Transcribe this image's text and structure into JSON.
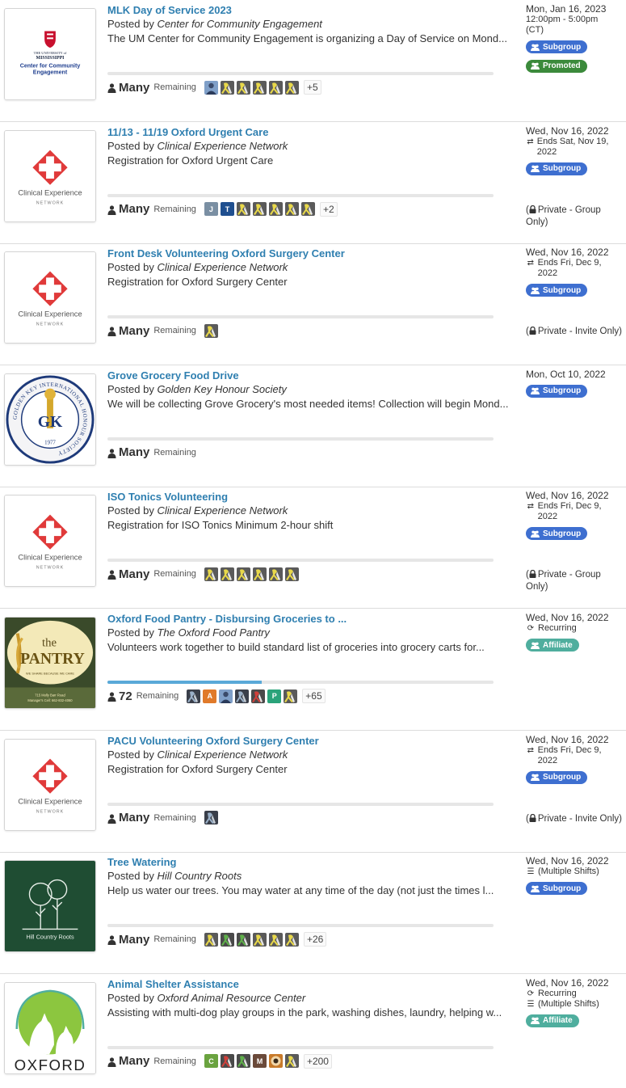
{
  "events": [
    {
      "title": "MLK Day of Service 2023",
      "posted_prefix": "Posted by ",
      "org": "Center for Community Engagement",
      "desc": "The UM Center for Community Engagement is organizing a Day of Service on  Mond...",
      "logo": "ole-miss",
      "logo_text": [
        "THE UNIVERSITY of",
        "MISSISSIPPI",
        "Center for Community",
        "Engagement"
      ],
      "count": "Many",
      "remaining": "Remaining",
      "progress": null,
      "avatars": [
        "photo-person",
        "ribbon",
        "ribbon",
        "ribbon",
        "ribbon",
        "ribbon"
      ],
      "more": "+5",
      "date": "Mon, Jan 16, 2023",
      "sublines": [
        {
          "icon": "",
          "text": "12:00pm - 5:00pm"
        },
        {
          "icon": "",
          "text": "(CT)"
        }
      ],
      "badges": [
        {
          "type": "sub",
          "label": "Subgroup"
        },
        {
          "type": "promo",
          "label": "Promoted"
        }
      ],
      "privacy": ""
    },
    {
      "title": "11/13 - 11/19 Oxford Urgent Care",
      "posted_prefix": "Posted by ",
      "org": "Clinical Experience Network",
      "desc": "Registration for Oxford Urgent Care",
      "logo": "clinical",
      "logo_text": [
        "Clinical Experience",
        "NETWORK"
      ],
      "count": "Many",
      "remaining": "Remaining",
      "progress": null,
      "avatars": [
        "letter-J",
        "letter-T",
        "ribbon",
        "ribbon",
        "ribbon",
        "ribbon",
        "ribbon"
      ],
      "more": "+2",
      "date": "Wed, Nov 16, 2022",
      "sublines": [
        {
          "icon": "⇄",
          "text": "Ends Sat, Nov 19, 2022"
        }
      ],
      "badges": [
        {
          "type": "sub",
          "label": "Subgroup"
        }
      ],
      "privacy": "Private - Group Only)"
    },
    {
      "title": "Front Desk Volunteering Oxford Surgery Center",
      "posted_prefix": "Posted by ",
      "org": "Clinical Experience Network",
      "desc": "Registration for Oxford Surgery Center",
      "logo": "clinical",
      "logo_text": [
        "Clinical Experience",
        "NETWORK"
      ],
      "count": "Many",
      "remaining": "Remaining",
      "progress": null,
      "avatars": [
        "ribbon"
      ],
      "more": "",
      "date": "Wed, Nov 16, 2022",
      "sublines": [
        {
          "icon": "⇄",
          "text": "Ends Fri, Dec 9, 2022"
        }
      ],
      "badges": [
        {
          "type": "sub",
          "label": "Subgroup"
        }
      ],
      "privacy": "Private - Invite Only)"
    },
    {
      "title": "Grove Grocery Food Drive",
      "posted_prefix": "Posted by ",
      "org": "Golden Key Honour Society",
      "desc": "We will be collecting Grove Grocery's most needed items! Collection will begin Mond...",
      "logo": "golden-key",
      "logo_text": [
        "GOLDEN KEY INTERNATIONAL HONOUR SOCIETY",
        "GK",
        "1977"
      ],
      "count": "Many",
      "remaining": "Remaining",
      "progress": null,
      "avatars": [],
      "more": "",
      "date": "Mon, Oct 10, 2022",
      "sublines": [],
      "badges": [
        {
          "type": "sub",
          "label": "Subgroup"
        }
      ],
      "privacy": ""
    },
    {
      "title": "ISO Tonics Volunteering",
      "posted_prefix": "Posted by ",
      "org": "Clinical Experience Network",
      "desc": "Registration for ISO Tonics Minimum 2-hour shift",
      "logo": "clinical",
      "logo_text": [
        "Clinical Experience",
        "NETWORK"
      ],
      "count": "Many",
      "remaining": "Remaining",
      "progress": null,
      "avatars": [
        "ribbon",
        "ribbon",
        "ribbon",
        "ribbon",
        "ribbon",
        "ribbon"
      ],
      "more": "",
      "date": "Wed, Nov 16, 2022",
      "sublines": [
        {
          "icon": "⇄",
          "text": "Ends Fri, Dec 9, 2022"
        }
      ],
      "badges": [
        {
          "type": "sub",
          "label": "Subgroup"
        }
      ],
      "privacy": "Private - Group Only)"
    },
    {
      "title": "Oxford Food Pantry - Disbursing Groceries to ...",
      "posted_prefix": "Posted by ",
      "org": "The Oxford Food Pantry",
      "desc": "Volunteers work together to build standard list of groceries into grocery carts for...",
      "logo": "pantry",
      "logo_text": [
        "the",
        "PANTRY",
        "WE SHARE BECAUSE WE CARE",
        "715 Molly Barr Road",
        "Manager's Cell: 662-832-4060"
      ],
      "count": "72",
      "remaining": "Remaining",
      "progress": 0.4,
      "avatars": [
        "ribbon-dark",
        "letter-A",
        "photo-person",
        "ribbon-dark",
        "ribbon-red",
        "letter-P",
        "ribbon"
      ],
      "more": "+65",
      "date": "Wed, Nov 16, 2022",
      "sublines": [
        {
          "icon": "⟳",
          "text": "Recurring"
        }
      ],
      "badges": [
        {
          "type": "aff",
          "label": "Affiliate"
        }
      ],
      "privacy": ""
    },
    {
      "title": "PACU Volunteering Oxford Surgery Center",
      "posted_prefix": "Posted by ",
      "org": "Clinical Experience Network",
      "desc": "Registration for Oxford Surgery Center",
      "logo": "clinical",
      "logo_text": [
        "Clinical Experience",
        "NETWORK"
      ],
      "count": "Many",
      "remaining": "Remaining",
      "progress": null,
      "avatars": [
        "ribbon-dark"
      ],
      "more": "",
      "date": "Wed, Nov 16, 2022",
      "sublines": [
        {
          "icon": "⇄",
          "text": "Ends Fri, Dec 9, 2022"
        }
      ],
      "badges": [
        {
          "type": "sub",
          "label": "Subgroup"
        }
      ],
      "privacy": "Private - Invite Only)"
    },
    {
      "title": "Tree Watering",
      "posted_prefix": "Posted by ",
      "org": "Hill Country Roots",
      "desc": "Help us water our trees. You may water at any time of the day (not just the times l...",
      "logo": "hill-country",
      "logo_text": [
        "Hill Country Roots"
      ],
      "count": "Many",
      "remaining": "Remaining",
      "progress": null,
      "avatars": [
        "ribbon",
        "ribbon-green",
        "ribbon-green",
        "ribbon",
        "ribbon",
        "ribbon"
      ],
      "more": "+26",
      "date": "Wed, Nov 16, 2022",
      "sublines": [
        {
          "icon": "☰",
          "text": "(Multiple Shifts)"
        }
      ],
      "badges": [
        {
          "type": "sub",
          "label": "Subgroup"
        }
      ],
      "privacy": ""
    },
    {
      "title": "Animal Shelter Assistance",
      "posted_prefix": "Posted by ",
      "org": "Oxford Animal Resource Center",
      "desc": "Assisting with multi-dog play groups in the park, washing dishes, laundry, helping w...",
      "logo": "oxford",
      "logo_text": [
        "OXFORD"
      ],
      "count": "Many",
      "remaining": "Remaining",
      "progress": null,
      "avatars": [
        "letter-C",
        "ribbon-red",
        "ribbon-green",
        "letter-M",
        "photo-dog",
        "ribbon"
      ],
      "more": "+200",
      "date": "Wed, Nov 16, 2022",
      "sublines": [
        {
          "icon": "⟳",
          "text": "Recurring"
        },
        {
          "icon": "☰",
          "text": "(Multiple Shifts)"
        }
      ],
      "badges": [
        {
          "type": "aff",
          "label": "Affiliate"
        }
      ],
      "privacy": ""
    }
  ],
  "colors": {
    "title_link": "#2f7fb0",
    "subgroup_badge": "#3e6fd0",
    "promoted_badge": "#3b8a3b",
    "affiliate_badge": "#4fae9e",
    "progress_fill": "#5aa9d8",
    "letter_J": "#7a8fa3",
    "letter_T": "#1f4f8f",
    "letter_A": "#e07a2a",
    "letter_P": "#2aa37a",
    "letter_C": "#6aa33f",
    "letter_M": "#6b4a3a"
  }
}
